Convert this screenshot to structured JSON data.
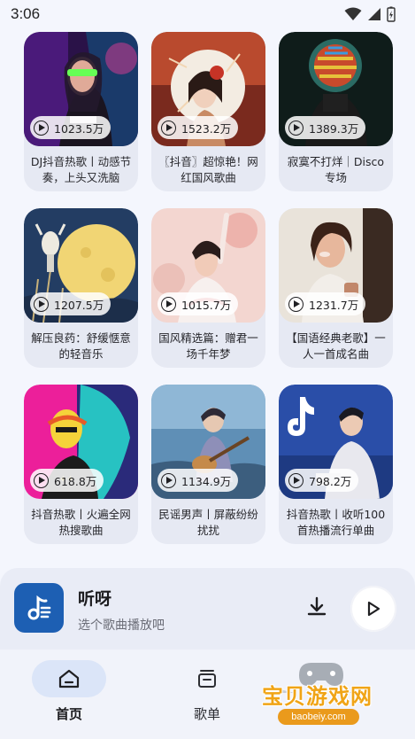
{
  "status_bar": {
    "time": "3:06"
  },
  "playlists": [
    {
      "count": "1023.5万",
      "title": "DJ抖音热歌丨动感节奏，上头又洗脑",
      "icon": "dj-girl-cover"
    },
    {
      "count": "1523.2万",
      "title": "〖抖音〗超惊艳！网红国风歌曲",
      "icon": "guofeng-girl-cover"
    },
    {
      "count": "1389.3万",
      "title": "寂寞不打烊｜Disco专场",
      "icon": "disco-cover"
    },
    {
      "count": "1207.5万",
      "title": "解压良药：舒缓惬意的轻音乐",
      "icon": "moon-illustration-cover"
    },
    {
      "count": "1015.7万",
      "title": "国风精选篇：赠君一场千年梦",
      "icon": "hanfu-girl-cover"
    },
    {
      "count": "1231.7万",
      "title": "【国语经典老歌】一人一首成名曲",
      "icon": "singer-coffee-cover"
    },
    {
      "count": "618.8万",
      "title": "抖音热歌丨火遍全网热搜歌曲",
      "icon": "pop-art-cover"
    },
    {
      "count": "1134.9万",
      "title": "民谣男声丨屏蔽纷纷扰扰",
      "icon": "guitar-boy-cover"
    },
    {
      "count": "798.2万",
      "title": "抖音热歌丨收听100首热播流行单曲",
      "icon": "tiktok-singer-cover"
    }
  ],
  "player": {
    "title": "听呀",
    "subtitle": "选个歌曲播放吧"
  },
  "nav": {
    "home": "首页",
    "playlist": "歌单"
  },
  "watermark": {
    "text": "宝贝游戏网",
    "url": "baobeiy.com"
  },
  "colors": {
    "accent": "#1d5fb3",
    "nav_active_bg": "#dbe5f8",
    "watermark": "#f0a416"
  }
}
